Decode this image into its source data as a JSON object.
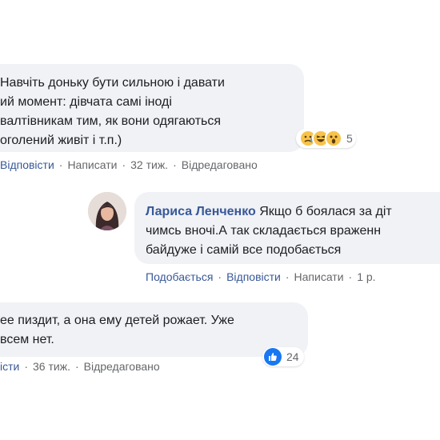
{
  "comment1": {
    "lines": [
      "Навчіть доньку бути сильною і давати",
      "ий момент: дівчата самі іноді",
      "валтівникам тим, як вони одягаються",
      "оголений живіт і т.п.)"
    ],
    "reaction_count": "5",
    "actions": {
      "reply": "Відповісти",
      "write": "Написати",
      "time": "32 тиж.",
      "edited": "Відредаговано"
    }
  },
  "reply": {
    "author": "Лариса Ленченко",
    "lines": [
      "Якщо б боялася за діт",
      "чимсь вночі.А так складається враженн",
      "байдуже і самій все подобається"
    ],
    "actions": {
      "like": "Подобається",
      "reply": "Відповісти",
      "write": "Написати",
      "time": "1 р."
    }
  },
  "comment2": {
    "lines": [
      "ее пиздит, а она ему детей рожает. Уже",
      "всем нет."
    ],
    "reaction_count": "24",
    "actions": {
      "reply": "істи",
      "time": "36 тиж.",
      "edited": "Відредаговано"
    }
  },
  "colors": {
    "link": "#385898",
    "bubble": "#f0f2f5",
    "muted": "#65676b",
    "like_blue": "#1877f2"
  },
  "icons": [
    "sad-emoji-icon",
    "haha-emoji-icon",
    "wow-emoji-icon",
    "like-icon"
  ]
}
